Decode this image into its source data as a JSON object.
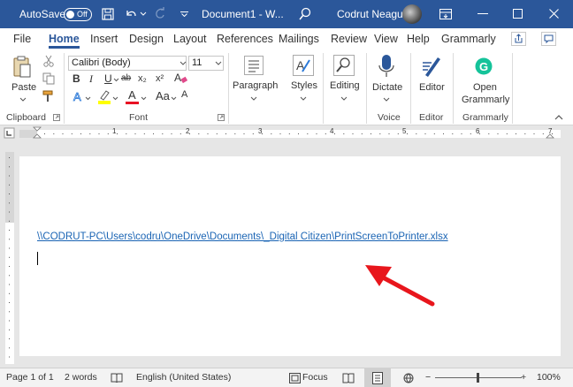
{
  "titlebar": {
    "autosave_label": "AutoSave",
    "autosave_state": "Off",
    "doc_title": "Document1 - W...",
    "user_name": "Codrut Neagu",
    "bg_color": "#2b579a"
  },
  "menu": {
    "tabs": [
      "File",
      "Home",
      "Insert",
      "Design",
      "Layout",
      "References",
      "Mailings",
      "Review",
      "View",
      "Help",
      "Grammarly"
    ],
    "active": "Home"
  },
  "ribbon": {
    "paste_label": "Paste",
    "font_name": "Calibri (Body)",
    "font_size": "11",
    "paragraph_label": "Paragraph",
    "styles_label": "Styles",
    "editing_label": "Editing",
    "dictate_label": "Dictate",
    "editor_label": "Editor",
    "open_grammarly_line1": "Open",
    "open_grammarly_line2": "Grammarly",
    "groups": {
      "clipboard": "Clipboard",
      "font": "Font",
      "voice": "Voice",
      "editor": "Editor",
      "grammarly": "Grammarly"
    },
    "format_buttons": {
      "bold": "B",
      "italic": "I",
      "underline": "U",
      "strike": "ab",
      "subscript": "x₂",
      "superscript": "x²",
      "font_color": "A",
      "text_effects": "A",
      "change_case": "Aa"
    }
  },
  "ruler": {
    "numbers": [
      "1",
      "2",
      "3",
      "4",
      "5",
      "6",
      "7"
    ]
  },
  "document": {
    "hyperlink_text": "\\\\CODRUT-PC\\Users\\codru\\OneDrive\\Documents\\_Digital Citizen\\PrintScreenToPrinter.xlsx",
    "link_color": "#1a64b4"
  },
  "statusbar": {
    "page": "Page 1 of 1",
    "words": "2 words",
    "language": "English (United States)",
    "focus": "Focus",
    "zoom_minus": "−",
    "zoom_plus": "+",
    "zoom": "100%"
  },
  "annotation": {
    "arrow_color": "#e8161c"
  }
}
